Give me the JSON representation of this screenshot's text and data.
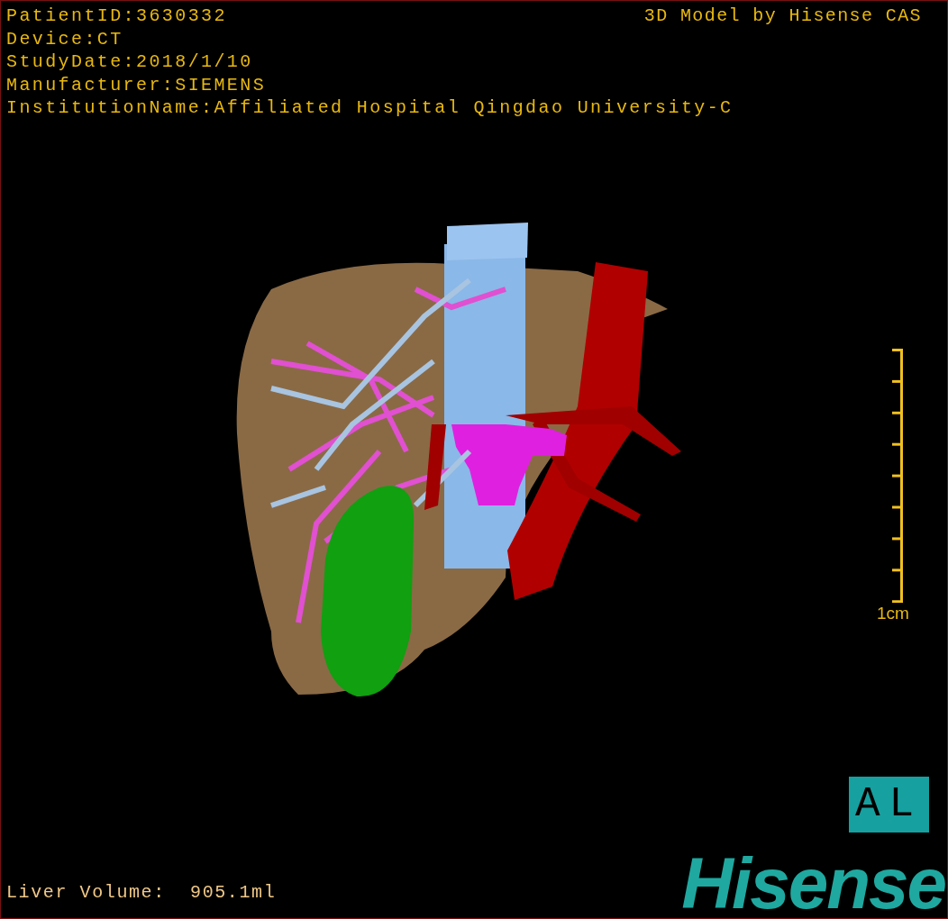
{
  "info_lines": [
    "PatientID:3630332",
    "Device:CT",
    "StudyDate:2018/1/10",
    "Manufacturer:SIEMENS",
    "InstitutionName:Affiliated Hospital Qingdao University-C"
  ],
  "title": "3D Model by Hisense CAS",
  "scale_bar": {
    "label": "1cm"
  },
  "orientation": "AL",
  "liver_volume": "Liver Volume:  905.1ml",
  "logo": "Hisense"
}
